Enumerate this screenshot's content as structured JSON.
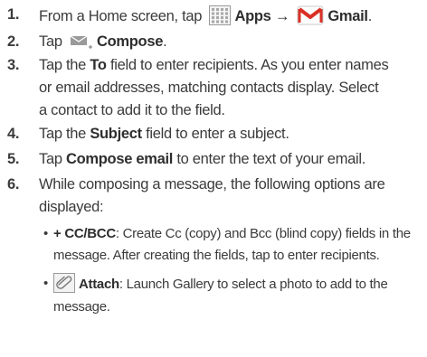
{
  "steps": [
    {
      "num": "1.",
      "prefix": "From a Home screen, tap",
      "apps_label": "Apps",
      "arrow": "→",
      "gmail_label": "Gmail",
      "suffix": ".",
      "icons": [
        "apps-grid-icon",
        "gmail-icon"
      ]
    },
    {
      "num": "2.",
      "prefix": "Tap",
      "compose_label": "Compose",
      "suffix": ".",
      "icons": [
        "compose-icon"
      ]
    },
    {
      "num": "3.",
      "lines": [
        {
          "a": "Tap the ",
          "b": "To",
          "c": " field to enter recipients. As you enter names"
        },
        {
          "a": "or email addresses, matching contacts display. Select"
        },
        {
          "a": "a contact to add it to the field."
        }
      ]
    },
    {
      "num": "4.",
      "a": "Tap the ",
      "b": "Subject",
      "c": " field to enter a subject."
    },
    {
      "num": "5.",
      "a": "Tap ",
      "b": "Compose email",
      "c": " to enter the text of your email."
    },
    {
      "num": "6.",
      "line1": "While composing a message, the following options are",
      "line2": "displayed:"
    }
  ],
  "options": [
    {
      "bullet": "•",
      "label": "+ CC/BCC",
      "line1": ": Create Cc (copy) and Bcc (blind copy) fields in the",
      "line2": "message. After creating the fields, tap to enter recipients."
    },
    {
      "bullet": "•",
      "label": "Attach",
      "line1": ": Launch Gallery to select a photo to add to the",
      "line2": "message.",
      "icon": "paperclip-icon"
    }
  ],
  "colors": {
    "text": "#3b3b3b",
    "gmail_red": "#d93025",
    "compose_gray": "#8a8a8a",
    "apps_grid": "#a8a8a8"
  }
}
